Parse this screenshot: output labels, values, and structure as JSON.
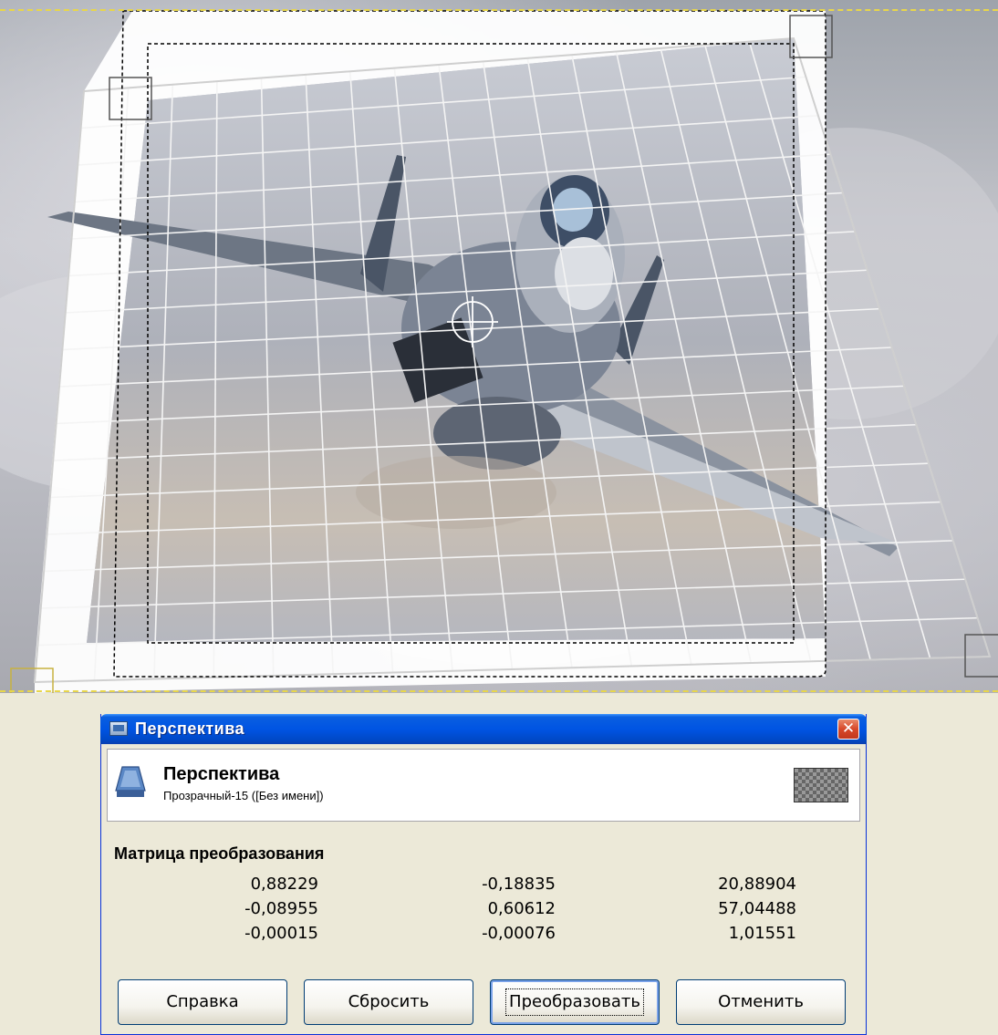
{
  "dialog": {
    "title": "Перспектива",
    "close_label": "✕",
    "header": {
      "title": "Перспектива",
      "subtitle": "Прозрачный-15 ([Без имени])"
    },
    "matrix_title": "Матрица преобразования",
    "matrix": [
      [
        "0,88229",
        "-0,18835",
        "20,88904"
      ],
      [
        "-0,08955",
        "0,60612",
        "57,04488"
      ],
      [
        "-0,00015",
        "-0,00076",
        "1,01551"
      ]
    ],
    "buttons": {
      "help": "Справка",
      "reset": "Сбросить",
      "transform": "Преобразовать",
      "cancel": "Отменить"
    }
  },
  "icons": {
    "dialog_icon": "image-window-icon",
    "tool_icon": "perspective-tool-icon",
    "close": "close-icon",
    "layer_preview": "layer-thumbnail"
  }
}
